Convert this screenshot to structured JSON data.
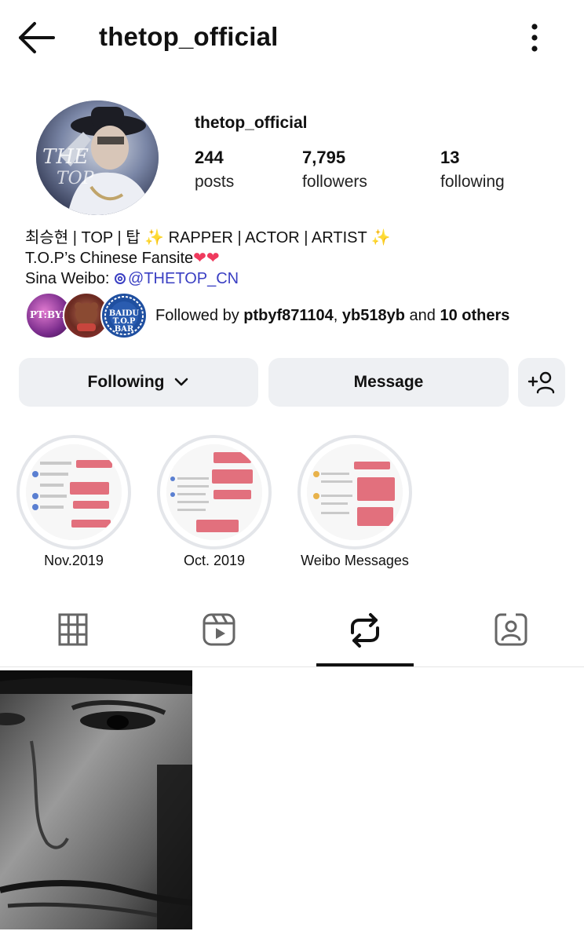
{
  "header": {
    "title": "thetop_official",
    "back_icon": "arrow-left-icon",
    "more_icon": "more-vertical-icon"
  },
  "profile": {
    "username": "thetop_official",
    "stats": [
      {
        "value": "244",
        "label": "posts"
      },
      {
        "value": "7,795",
        "label": "followers"
      },
      {
        "value": "13",
        "label": "following"
      }
    ],
    "bio": {
      "line1_text": "최승현 | TOP | 탑 ",
      "line1_sparkle1": "✨",
      "line1_middle": " RAPPER | ACTOR | ARTIST ",
      "line1_sparkle2": "✨",
      "line2_text": "T.O.P’s Chinese Fansite",
      "line2_hearts": "❤❤",
      "line3_prefix": "Sina Weibo: ",
      "line3_link": "@THETOP_CN"
    }
  },
  "followed_by": {
    "prefix": "Followed by ",
    "user1": "ptbyf871104",
    "sep": ", ",
    "user2": "yb518yb",
    "and": " and ",
    "others": "10 others",
    "avatar_labels": [
      "PT:BYF",
      "",
      "BAIDU T.O.P BAR"
    ]
  },
  "actions": {
    "following_label": "Following",
    "message_label": "Message"
  },
  "highlights": [
    {
      "label": "Nov.2019"
    },
    {
      "label": "Oct. 2019"
    },
    {
      "label": "Weibo Messages"
    }
  ],
  "tabs": [
    {
      "icon": "grid-icon",
      "active": false
    },
    {
      "icon": "reels-icon",
      "active": false
    },
    {
      "icon": "repost-icon",
      "active": true
    },
    {
      "icon": "tagged-icon",
      "active": false
    }
  ],
  "colors": {
    "button_bg": "#eef0f3",
    "link": "#3a3fc3",
    "heart": "#ef3a5d",
    "text": "#111111"
  }
}
